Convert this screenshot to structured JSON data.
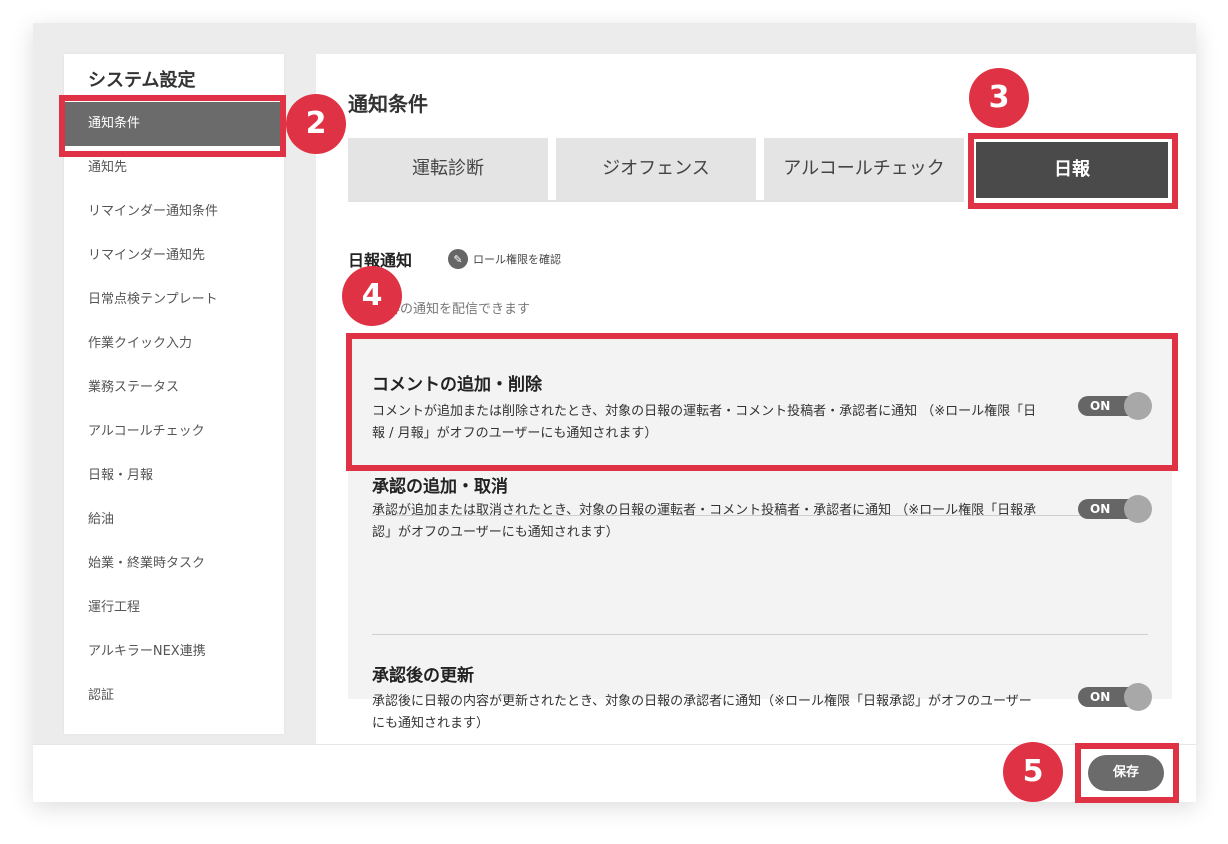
{
  "sidebar": {
    "title": "システム設定",
    "items": [
      {
        "label": "通知条件",
        "active": true
      },
      {
        "label": "通知先"
      },
      {
        "label": "リマインダー通知条件"
      },
      {
        "label": "リマインダー通知先"
      },
      {
        "label": "日常点検テンプレート"
      },
      {
        "label": "作業クイック入力"
      },
      {
        "label": "業務ステータス"
      },
      {
        "label": "アルコールチェック"
      },
      {
        "label": "日報・月報"
      },
      {
        "label": "給油"
      },
      {
        "label": "始業・終業時タスク"
      },
      {
        "label": "運行工程"
      },
      {
        "label": "アルキラーNEX連携"
      },
      {
        "label": "認証"
      }
    ]
  },
  "main": {
    "title": "通知条件",
    "tabs": [
      {
        "label": "運転診断"
      },
      {
        "label": "ジオフェンス"
      },
      {
        "label": "アルコールチェック"
      },
      {
        "label": "日報",
        "active": true
      }
    ],
    "section": {
      "title": "日報通知",
      "role_link": "ロール権限を確認",
      "description": "日報内容の通知を配信できます"
    },
    "settings": [
      {
        "title": "コメントの追加・削除",
        "description": "コメントが追加または削除されたとき、対象の日報の運転者・コメント投稿者・承認者に通知 （※ロール権限「日報 / 月報」がオフのユーザーにも通知されます）",
        "toggle": "ON"
      },
      {
        "title": "承認の追加・取消",
        "description": "承認が追加または取消されたとき、対象の日報の運転者・コメント投稿者・承認者に通知 （※ロール権限「日報承認」がオフのユーザーにも通知されます）",
        "toggle": "ON"
      },
      {
        "title": "承認後の更新",
        "description": "承認後に日報の内容が更新されたとき、対象の日報の承認者に通知（※ロール権限「日報承認」がオフのユーザーにも通知されます）",
        "toggle": "ON"
      }
    ]
  },
  "footer": {
    "save_label": "保存"
  },
  "annotations": {
    "badges": [
      "2",
      "3",
      "4",
      "5"
    ],
    "color": "#e03245"
  },
  "colors": {
    "active_dark": "#4a4a4a",
    "sidebar_active": "#6b6b6b",
    "toggle_track": "#666666"
  }
}
